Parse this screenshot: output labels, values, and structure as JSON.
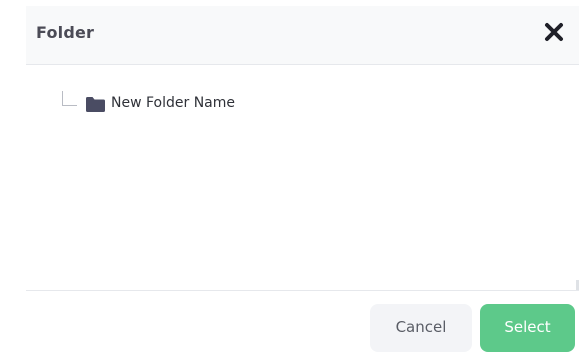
{
  "dialog": {
    "title": "Folder",
    "close_icon": "close-icon"
  },
  "tree": {
    "items": [
      {
        "label": "New Folder Name",
        "icon": "folder-icon"
      }
    ]
  },
  "footer": {
    "cancel_label": "Cancel",
    "select_label": "Select"
  },
  "colors": {
    "header_bg": "#f8f9fa",
    "title": "#4b4b56",
    "folder_icon": "#4a4c63",
    "select_button": "#5dc98a",
    "cancel_button": "#f3f4f7"
  }
}
